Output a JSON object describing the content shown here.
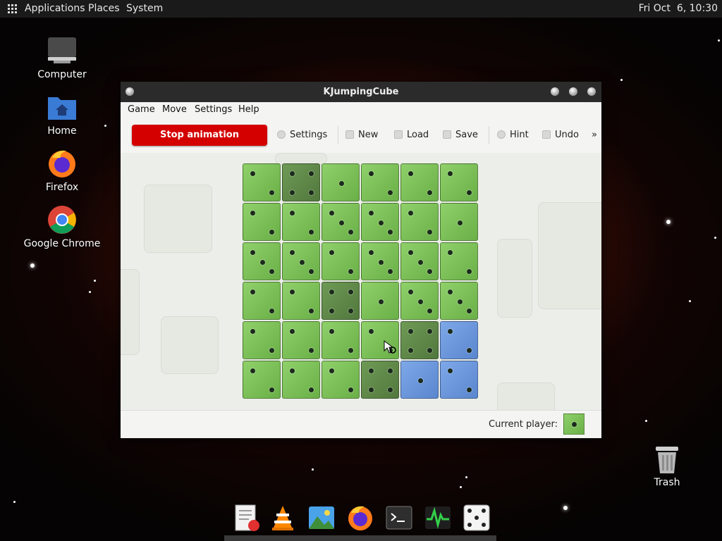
{
  "top_panel": {
    "applications": "Applications",
    "places": "Places",
    "system": "System",
    "clock": "Fri Oct  6, 10:30"
  },
  "desktop": {
    "icons": [
      {
        "label": "Computer"
      },
      {
        "label": "Home"
      },
      {
        "label": "Firefox"
      },
      {
        "label": "Google Chrome"
      }
    ],
    "trash": "Trash"
  },
  "window": {
    "title": "KJumpingCube",
    "menu": {
      "game": "Game",
      "move": "Move",
      "settings": "Settings",
      "help": "Help"
    },
    "toolbar": {
      "stop_animation": "Stop animation",
      "settings": "Settings",
      "new": "New",
      "load": "Load",
      "save": "Save",
      "hint": "Hint",
      "undo": "Undo",
      "more": "»"
    },
    "board": {
      "rows": [
        [
          {
            "c": "green",
            "n": 2
          },
          {
            "c": "dark",
            "n": 4
          },
          {
            "c": "green",
            "n": 1
          },
          {
            "c": "green",
            "n": 2
          },
          {
            "c": "green",
            "n": 2
          },
          {
            "c": "green",
            "n": 2
          }
        ],
        [
          {
            "c": "green",
            "n": 2
          },
          {
            "c": "green",
            "n": 2
          },
          {
            "c": "green",
            "n": 3
          },
          {
            "c": "green",
            "n": 3
          },
          {
            "c": "green",
            "n": 2
          },
          {
            "c": "green",
            "n": 1
          }
        ],
        [
          {
            "c": "green",
            "n": 3
          },
          {
            "c": "green",
            "n": 3
          },
          {
            "c": "green",
            "n": 2
          },
          {
            "c": "green",
            "n": 3
          },
          {
            "c": "green",
            "n": 3
          },
          {
            "c": "green",
            "n": 2
          }
        ],
        [
          {
            "c": "green",
            "n": 2
          },
          {
            "c": "green",
            "n": 2
          },
          {
            "c": "dark",
            "n": 4
          },
          {
            "c": "green",
            "n": 1
          },
          {
            "c": "green",
            "n": 3
          },
          {
            "c": "green",
            "n": 3
          }
        ],
        [
          {
            "c": "green",
            "n": 2
          },
          {
            "c": "green",
            "n": 2
          },
          {
            "c": "green",
            "n": 2
          },
          {
            "c": "green",
            "n": 2
          },
          {
            "c": "dark",
            "n": 4
          },
          {
            "c": "blue",
            "n": 2
          }
        ],
        [
          {
            "c": "green",
            "n": 2
          },
          {
            "c": "green",
            "n": 2
          },
          {
            "c": "green",
            "n": 2
          },
          {
            "c": "dark",
            "n": 4
          },
          {
            "c": "blue",
            "n": 1
          },
          {
            "c": "blue",
            "n": 2
          }
        ]
      ]
    },
    "status": {
      "current_player_label": "Current player:"
    }
  },
  "colors": {
    "stop_button": "#d40000",
    "player1_green": "#7cc059",
    "player2_blue": "#6a95dc"
  }
}
